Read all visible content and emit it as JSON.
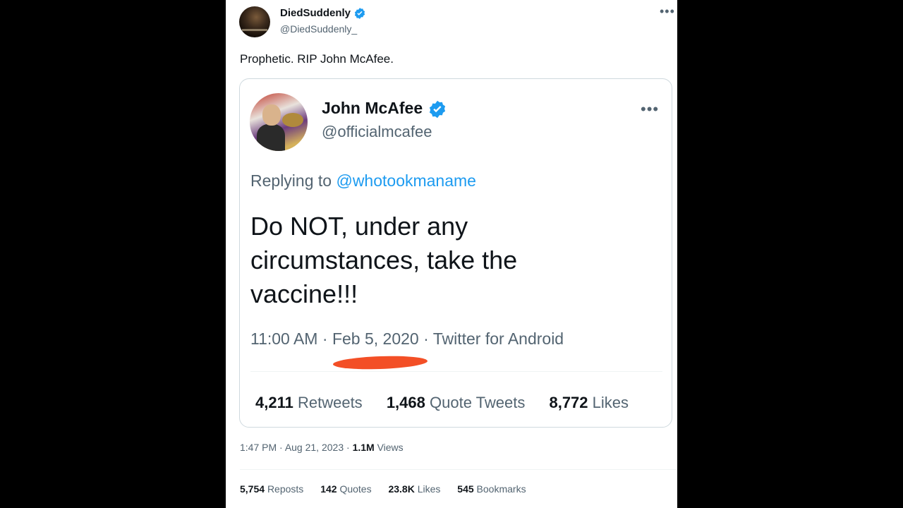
{
  "outer_tweet": {
    "author_name": "DiedSuddenly",
    "author_handle": "@DiedSuddenly_",
    "more": "•••",
    "text": "Prophetic. RIP John McAfee.",
    "time": "1:47 PM",
    "date": "Aug 21, 2023",
    "views_count": "1.1M",
    "views_label": "Views",
    "stats": {
      "reposts_count": "5,754",
      "reposts_label": "Reposts",
      "quotes_count": "142",
      "quotes_label": "Quotes",
      "likes_count": "23.8K",
      "likes_label": "Likes",
      "bookmarks_count": "545",
      "bookmarks_label": "Bookmarks"
    }
  },
  "quoted_tweet": {
    "author_name": "John McAfee",
    "author_handle": "@officialmcafee",
    "more": "•••",
    "replying_prefix": "Replying to",
    "replying_to": "@whotookmaname",
    "text": "Do NOT, under any circumstances, take the vaccine!!!",
    "time": "11:00 AM",
    "date": "Feb 5, 2020",
    "client": "Twitter for Android",
    "stats": {
      "retweets_count": "4,211",
      "retweets_label": "Retweets",
      "quote_tweets_count": "1,468",
      "quote_tweets_label": "Quote Tweets",
      "likes_count": "8,772",
      "likes_label": "Likes"
    }
  },
  "colors": {
    "verified_badge": "#1d9bf0",
    "link": "#1d9bf0",
    "annotation_underline": "#f2461a",
    "secondary_text": "#536471",
    "primary_text": "#0f1419"
  }
}
